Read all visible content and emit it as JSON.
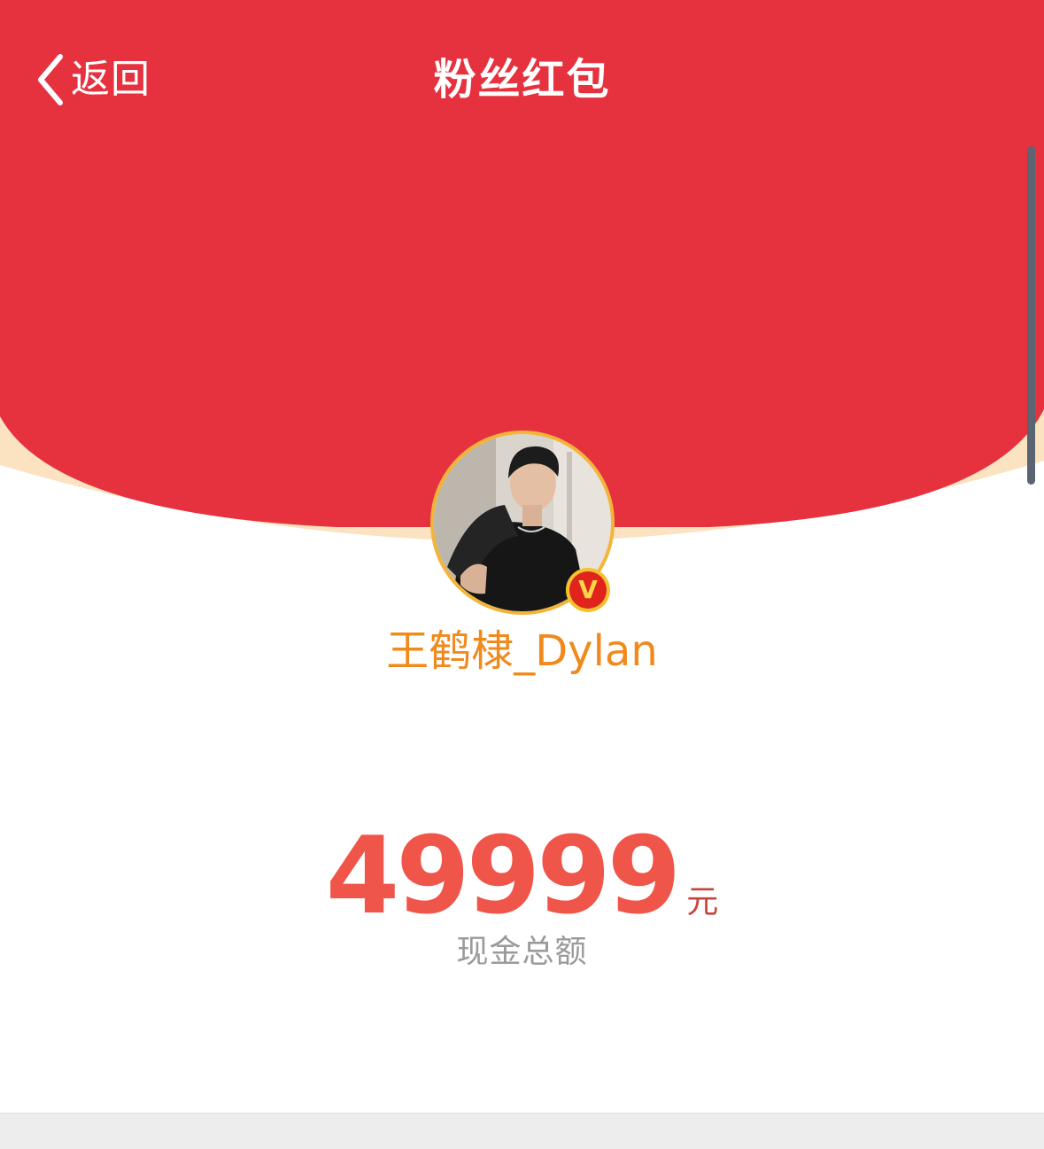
{
  "header": {
    "back_label": "返回",
    "title": "粉丝红包"
  },
  "profile": {
    "username": "王鹤棣_Dylan",
    "verified_mark": "V"
  },
  "amount": {
    "value": "49999",
    "unit": "元",
    "caption": "现金总额"
  },
  "theme": {
    "header_red": "#E6323F",
    "rim_cream": "#FBE3C2",
    "username_orange": "#F08A1C",
    "amount_red": "#F0554A"
  }
}
